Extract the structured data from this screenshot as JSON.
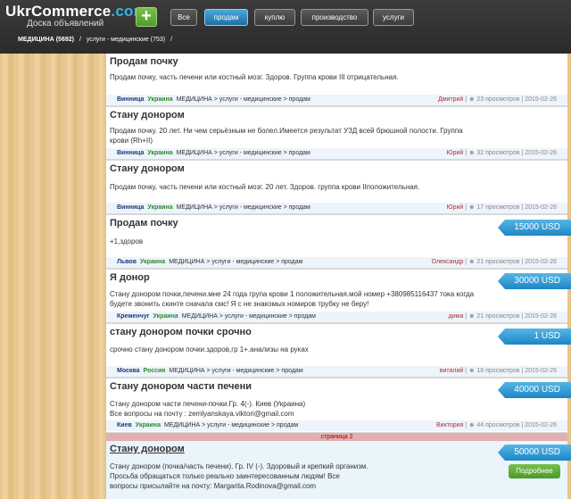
{
  "header": {
    "logo_main": "UkrCommerce",
    "logo_tld": ".com",
    "tagline": "Доска объявлений",
    "add_label": "+"
  },
  "nav": [
    "Все",
    "продам",
    "куплю",
    "производство",
    "услуги"
  ],
  "crumbs": {
    "c1": "МЕДИЦИНА (5692)",
    "sep": "/",
    "c2": "услуги - медицинские (753)",
    "sep2": "/"
  },
  "ads": [
    {
      "title": "Продам почку",
      "desc": "Продам почку, часть печени или костный мозг. Здоров. Группа крови III отрицательная.",
      "city": "Винница",
      "country": "Украина",
      "cat": "МЕДИЦИНА > услуги - медицинские > продам",
      "user": "Дмитрий",
      "views": "23 просмотров",
      "date": "2015-02-26"
    },
    {
      "title": "Стану донором",
      "desc": "Продам почку. 20 лет. Ни чем серьёзным не болел.Имеется результат УЗД всей брюшной полости. Группа крови (Rh+II)",
      "city": "Винница",
      "country": "Украина",
      "cat": "МЕДИЦИНА > услуги - медицинские > продам",
      "user": "Юрий",
      "views": "32 просмотров",
      "date": "2015-02-26"
    },
    {
      "title": "Стану донором",
      "desc": "Продам почку, часть печени или костный мозг. 20 лет. Здоров. группа крови IIположительная.",
      "city": "Винница",
      "country": "Украина",
      "cat": "МЕДИЦИНА > услуги - медицинские > продам",
      "user": "Юрий",
      "views": "17 просмотров",
      "date": "2015-02-26"
    },
    {
      "title": "Продам почку",
      "desc": "+1,здоров",
      "city": "Львов",
      "country": "Украина",
      "cat": "МЕДИЦИНА > услуги - медицинские > продам",
      "user": "Олександр",
      "views": "21 просмотров",
      "date": "2015-02-26",
      "price": "15000 USD"
    },
    {
      "title": "Я донор",
      "desc": "Стану донором почки,печени.мне 24 года група крови 1 положительная.мой номер +380985116437 тока когда будете звонить скинте сначала смс! Я с не знакомых номиров трубку не беру!",
      "city": "Кременчуг",
      "country": "Украина",
      "cat": "МЕДИЦИНА > услуги - медицинские > продам",
      "user": "дима",
      "views": "21 просмотров",
      "date": "2015-02-26",
      "price": "30000 USD"
    },
    {
      "title": "стану донором почки срочно",
      "desc": "срочно стану донором почки.здоров,гр 1+.анализы на руках",
      "city": "Москва",
      "country": "Россия",
      "cat": "МЕДИЦИНА > услуги - медицинские > продам",
      "user": "виталий",
      "views": "18 просмотров",
      "date": "2015-02-26",
      "price": "1 USD"
    },
    {
      "title": "Стану донором части печени",
      "desc": "Стану донором части печени-почки.Гр. 4(-). Киев (Украина) Все вопросы на почту : zemlyanskaya.viktori@gmail.com",
      "city": "Киев",
      "country": "Украина",
      "cat": "МЕДИЦИНА > услуги - медицинские > продам",
      "user": "Виктория",
      "views": "44 просмотров",
      "date": "2015-02-26",
      "price": "40000 USD"
    },
    {
      "title": "Стану донором",
      "desc": "Стану донором (почка/часть печени). Гр. IV (-). Здоровый и крепкий организм. Просьба обращаться только реально заинтересованным людям! Все вопросы присылайте на почту: Margarita.Rodinova@gmail.com",
      "price": "50000 USD",
      "more": "Подробнее"
    }
  ],
  "page2": "страница 2"
}
